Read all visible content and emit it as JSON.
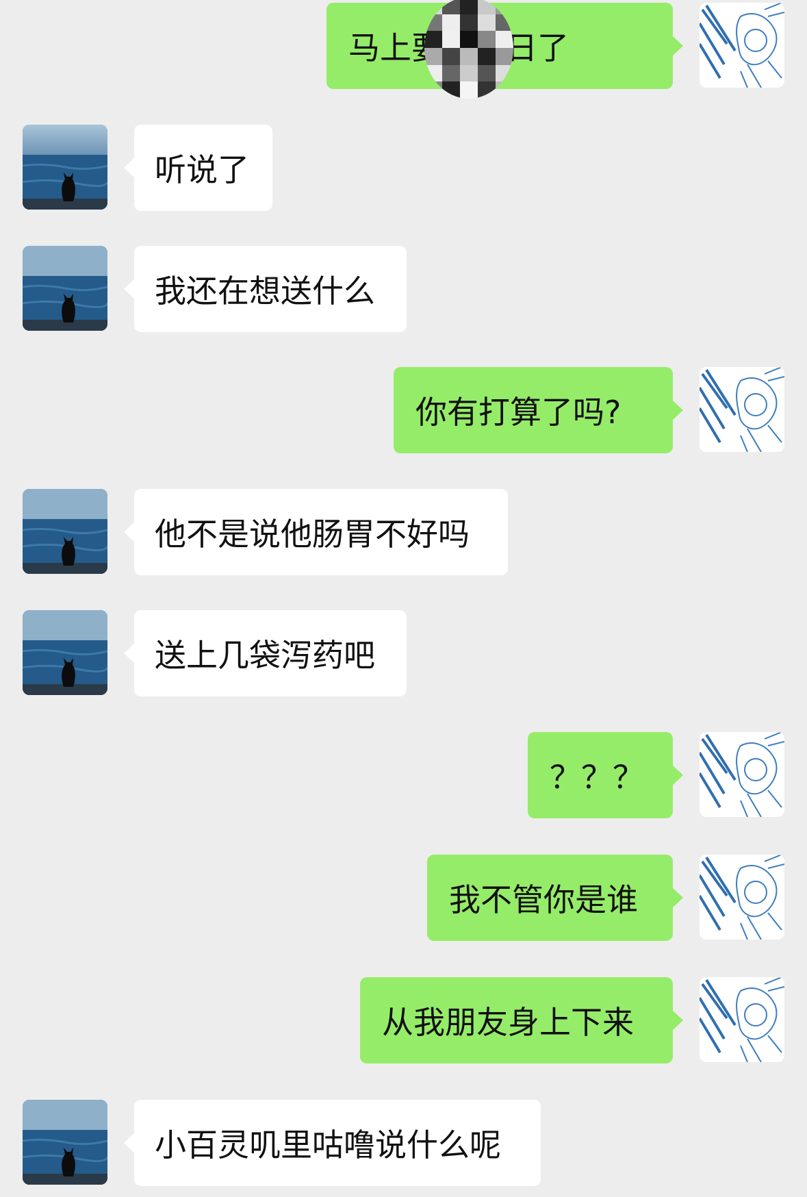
{
  "chat": {
    "messages": [
      {
        "side": "out",
        "text": "马上要过生日了",
        "redacted": true
      },
      {
        "side": "in",
        "text": "听说了"
      },
      {
        "side": "in",
        "text": "我还在想送什么"
      },
      {
        "side": "out",
        "text": "你有打算了吗?"
      },
      {
        "side": "in",
        "text": "他不是说他肠胃不好吗"
      },
      {
        "side": "in",
        "text": "送上几袋泻药吧"
      },
      {
        "side": "out",
        "text": "？？？"
      },
      {
        "side": "out",
        "text": "我不管你是谁"
      },
      {
        "side": "out",
        "text": "从我朋友身上下来"
      },
      {
        "side": "in",
        "text": "小百灵叽里咕噜说什么呢"
      }
    ]
  },
  "colors": {
    "background": "#ededed",
    "incoming_bubble": "#ffffff",
    "outgoing_bubble": "#95ec69"
  },
  "avatars": {
    "incoming": "cat-by-sea-avatar",
    "outgoing": "sketch-character-avatar"
  }
}
